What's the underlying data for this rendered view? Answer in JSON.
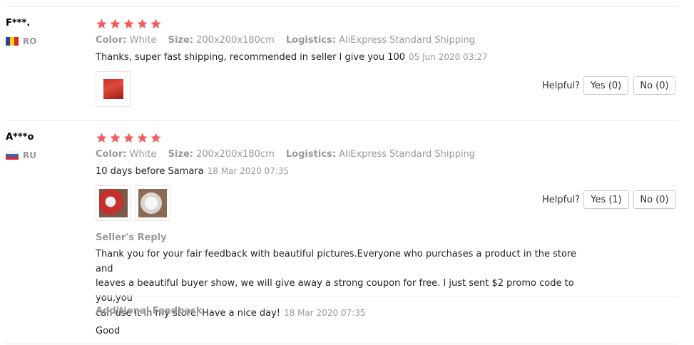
{
  "labels": {
    "color": "Color:",
    "size": "Size:",
    "logistics": "Logistics:",
    "helpful": "Helpful?",
    "seller_reply": "Seller's Reply",
    "additional_feedback": "Additional Feedback"
  },
  "colors": {
    "star": "#f25d5d",
    "muted": "#999999",
    "divider": "#e8e8e8"
  },
  "reviews": [
    {
      "user": "F***.",
      "country": "RO",
      "flag_icon": "romania-flag-icon",
      "rating": 5,
      "color": "White",
      "size": "200x200x180cm",
      "logistics": "AliExpress Standard Shipping",
      "text": "Thanks, super fast shipping, recommended in seller I give you 100",
      "date": "05 Jun 2020 03:27",
      "yes": "Yes (0)",
      "no": "No (0)"
    },
    {
      "user": "A***o",
      "country": "RU",
      "flag_icon": "russia-flag-icon",
      "rating": 5,
      "color": "White",
      "size": "200x200x180cm",
      "logistics": "AliExpress Standard Shipping",
      "text": "10 days before Samara",
      "date": "18 Mar 2020 07:35",
      "yes": "Yes (1)",
      "no": "No (0)",
      "seller_reply": {
        "line1": "Thank you for your fair feedback with beautiful pictures.Everyone who purchases a product in the store and",
        "line2": "leaves a beautiful buyer show, we will give away a strong coupon for free. I just sent $2 promo code to you,you",
        "line3": "can use it in my store. Have a nice day!",
        "date": "18 Mar 2020 07:35"
      },
      "additional_feedback": "Good"
    }
  ]
}
